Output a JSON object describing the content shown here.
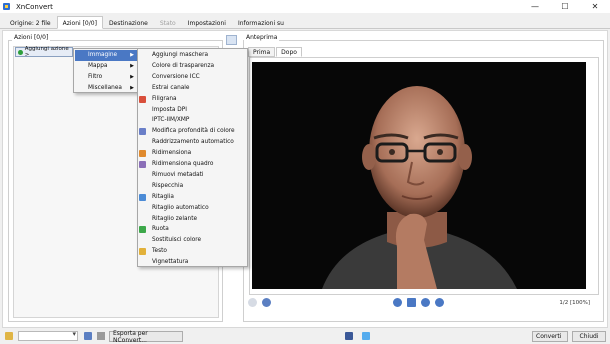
{
  "window": {
    "title": "XnConvert",
    "minimize": "—",
    "maximize": "☐",
    "close": "✕"
  },
  "tabs": [
    "Origine: 2 file",
    "Azioni [0/0]",
    "Destinazione",
    "Stato",
    "Impostazioni",
    "Informazioni su"
  ],
  "actions_panel": {
    "label": "Azioni [0/0]",
    "add_button": "Aggiungi azione >"
  },
  "menu_main": [
    {
      "label": "Immagine",
      "selected": true
    },
    {
      "label": "Mappa"
    },
    {
      "label": "Filtro"
    },
    {
      "label": "Miscellanea"
    }
  ],
  "menu_image": [
    {
      "label": "Aggiungi maschera",
      "icon": ""
    },
    {
      "label": "Colore di trasparenza",
      "icon": ""
    },
    {
      "label": "Conversione ICC",
      "icon": ""
    },
    {
      "label": "Estrai canale",
      "icon": ""
    },
    {
      "label": "Filigrana",
      "icon": "#d94f3b"
    },
    {
      "label": "Imposta DPI",
      "icon": ""
    },
    {
      "label": "IPTC-IIM/XMP",
      "icon": ""
    },
    {
      "label": "Modifica profondità di colore",
      "icon": "#6a7fc8"
    },
    {
      "label": "Raddrizzamento automatico",
      "icon": ""
    },
    {
      "label": "Ridimensiona",
      "icon": "#e08a2e"
    },
    {
      "label": "Ridimensiona quadro",
      "icon": "#8b6fb8"
    },
    {
      "label": "Rimuovi metadati",
      "icon": ""
    },
    {
      "label": "Rispecchia",
      "icon": ""
    },
    {
      "label": "Ritaglia",
      "icon": "#4b8bd6"
    },
    {
      "label": "Ritaglio automatico",
      "icon": ""
    },
    {
      "label": "Ritaglio zelante",
      "icon": ""
    },
    {
      "label": "Ruota",
      "icon": "#3da84a"
    },
    {
      "label": "Sostituisci colore",
      "icon": ""
    },
    {
      "label": "Testo",
      "icon": "#e2b13a"
    },
    {
      "label": "Vignettatura",
      "icon": ""
    }
  ],
  "preview_panel": {
    "label": "Anteprima",
    "tabs": [
      "Prima",
      "Dopo"
    ],
    "zoom": "1/2 [100%]"
  },
  "bottom": {
    "export_label": "Esporta per NConvert...",
    "convert_label": "Converti",
    "close_label": "Chiudi"
  }
}
